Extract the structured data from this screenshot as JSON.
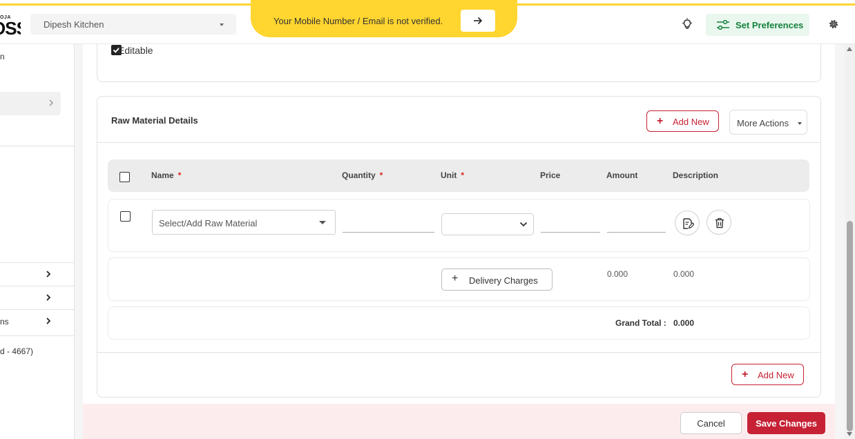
{
  "header": {
    "logo_small": "OJA",
    "logo_big": "OSS",
    "outlet": "Dipesh Kitchen",
    "banner_text": "Your Mobile Number / Email is not verified.",
    "preferences_label": "Set Preferences"
  },
  "sidebar": {
    "fragment_top": "n",
    "item_1": "",
    "item_2": "",
    "item_3": "ns",
    "footer_text": "d - 4667)"
  },
  "form": {
    "editable_label": "Editable",
    "editable_checked": true
  },
  "raw_material": {
    "title": "Raw Material Details",
    "add_new_label": "Add New",
    "more_actions_label": "More Actions",
    "columns": {
      "name": "Name",
      "quantity": "Quantity",
      "unit": "Unit",
      "price": "Price",
      "amount": "Amount",
      "description": "Description"
    },
    "required_mark": "*",
    "row": {
      "material_placeholder": "Select/Add Raw Material",
      "quantity": "",
      "unit": "",
      "price": "",
      "amount": ""
    },
    "delivery_label": "Delivery Charges",
    "delivery_amount": "0.000",
    "delivery_description": "0.000",
    "grand_total_label": "Grand Total :",
    "grand_total_value": "0.000",
    "add_new_bottom_label": "Add New"
  },
  "actions": {
    "cancel_label": "Cancel",
    "save_label": "Save Changes"
  },
  "colors": {
    "brand_red": "#c62134",
    "banner_yellow": "#ffd52f",
    "prefs_green": "#15803d"
  }
}
